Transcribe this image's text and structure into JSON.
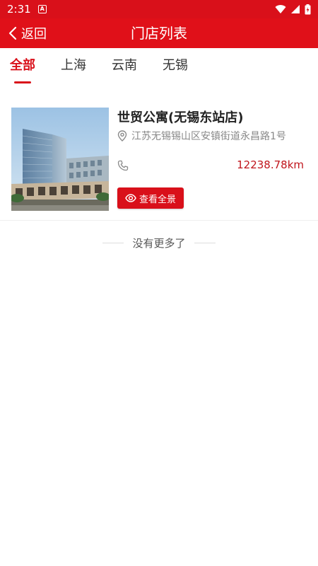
{
  "status_bar": {
    "time": "2:31",
    "notif_glyph": "A"
  },
  "app_bar": {
    "back_label": "返回",
    "title": "门店列表"
  },
  "tabs": [
    {
      "label": "全部",
      "active": true
    },
    {
      "label": "上海",
      "active": false
    },
    {
      "label": "云南",
      "active": false
    },
    {
      "label": "无锡",
      "active": false
    }
  ],
  "stores": [
    {
      "name": "世贸公寓(无锡东站店)",
      "address": "江苏无锡锡山区安镇街道永昌路1号",
      "distance": "12238.78km",
      "panorama_label": "查看全景"
    }
  ],
  "footer": {
    "no_more_text": "没有更多了"
  },
  "colors": {
    "brand_red": "#e01019",
    "distance_red": "#c0151c"
  }
}
